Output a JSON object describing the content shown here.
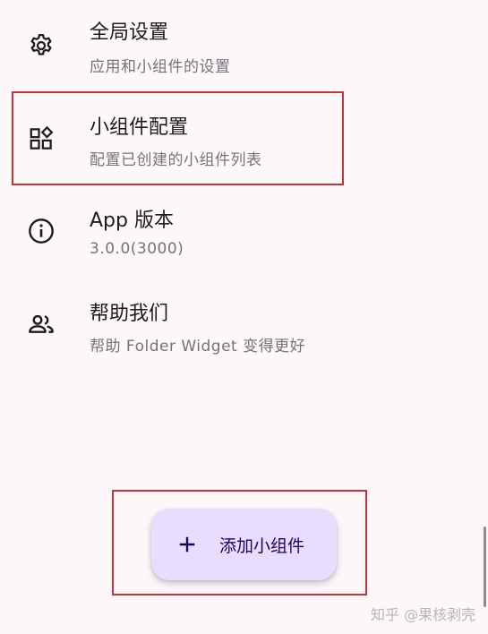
{
  "settings": {
    "items": [
      {
        "icon": "gear-icon",
        "title": "全局设置",
        "subtitle": "应用和小组件的设置"
      },
      {
        "icon": "widgets-icon",
        "title": "小组件配置",
        "subtitle": "配置已创建的小组件列表"
      },
      {
        "icon": "info-icon",
        "title": "App 版本",
        "subtitle": "3.0.0(3000)"
      },
      {
        "icon": "people-icon",
        "title": "帮助我们",
        "subtitle": "帮助 Folder Widget 变得更好"
      }
    ]
  },
  "fab": {
    "icon": "plus-icon",
    "label": "添加小组件"
  },
  "watermark": "知乎 @果核剥壳",
  "colors": {
    "background": "#fdf7fa",
    "fab_background": "#e9ddff",
    "fab_text": "#21005d",
    "highlight": "#c8323a",
    "subtitle": "#76727b"
  }
}
